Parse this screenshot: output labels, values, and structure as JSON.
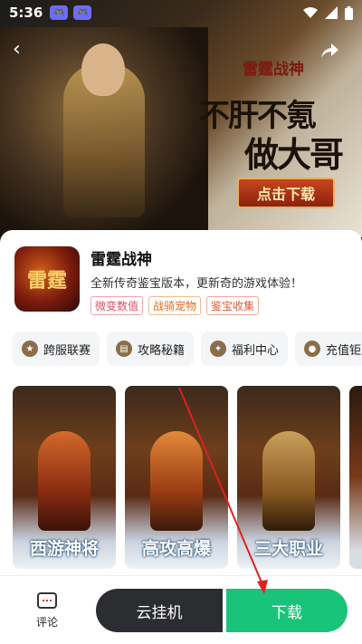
{
  "status_bar": {
    "time": "5:36",
    "icons": [
      "game-controller-icon",
      "game-controller-icon",
      "wifi-icon",
      "signal-icon",
      "battery-icon"
    ]
  },
  "banner": {
    "logo": "雷霆战神",
    "slogan_line1": "不肝不氪",
    "slogan_line2": "做大哥",
    "cta": "点击下载"
  },
  "game": {
    "title": "雷霆战神",
    "description": "全新传奇鉴宝版本，更新奇的游戏体验！",
    "icon_text": "雷霆",
    "tags": [
      "微变数值",
      "战骑宠物",
      "鉴宝收集"
    ]
  },
  "quick_links": [
    {
      "label": "跨服联赛",
      "icon": "trophy-icon"
    },
    {
      "label": "攻略秘籍",
      "icon": "book-icon"
    },
    {
      "label": "福利中心",
      "icon": "gift-icon"
    },
    {
      "label": "充值钜惠",
      "icon": "coin-icon"
    }
  ],
  "screenshots": [
    {
      "caption": "西游神将"
    },
    {
      "caption": "高攻高爆"
    },
    {
      "caption": "三大职业"
    }
  ],
  "bottom_bar": {
    "comment_label": "评论",
    "cloud_label": "云挂机",
    "download_label": "下载"
  },
  "colors": {
    "download": "#19c47a",
    "cloud": "#2b2d31",
    "annotation_arrow": "#e02020"
  }
}
